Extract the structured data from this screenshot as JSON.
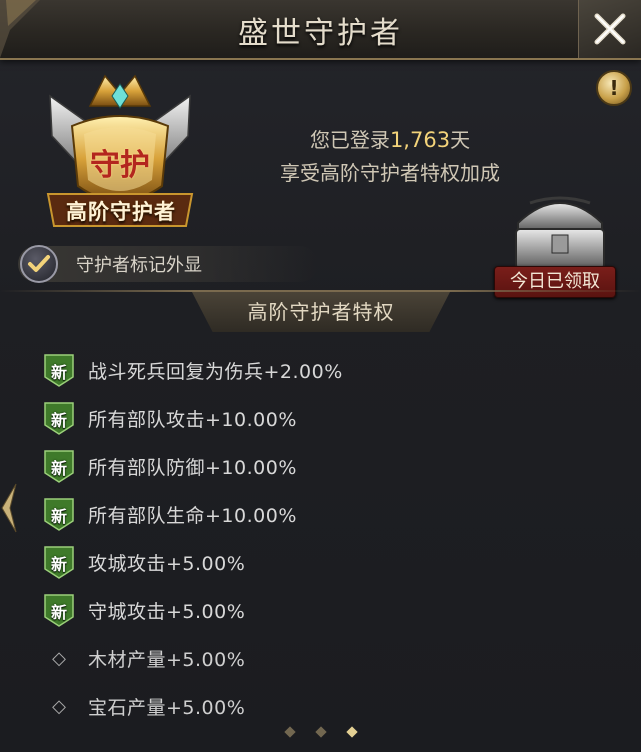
{
  "window": {
    "title": "盛世守护者",
    "close_icon": "close-x-icon",
    "info_icon": "exclamation-icon"
  },
  "emblem": {
    "center_text": "守护",
    "label": "高阶守护者"
  },
  "status": {
    "login_prefix": "您已登录",
    "login_days": "1,763",
    "login_suffix": "天",
    "privilege_line": "享受高阶守护者特权加成"
  },
  "chest": {
    "badge": "今日已领取"
  },
  "display_mark": {
    "label": "守护者标记外显",
    "checked": true
  },
  "privileges": {
    "header": "高阶守护者特权",
    "new_badge": "新",
    "items": [
      {
        "text": "战斗死兵回复为伤兵+2.00%",
        "new": true
      },
      {
        "text": "所有部队攻击+10.00%",
        "new": true
      },
      {
        "text": "所有部队防御+10.00%",
        "new": true
      },
      {
        "text": "所有部队生命+10.00%",
        "new": true
      },
      {
        "text": "攻城攻击+5.00%",
        "new": true
      },
      {
        "text": "守城攻击+5.00%",
        "new": true
      },
      {
        "text": "木材产量+5.00%",
        "new": false
      },
      {
        "text": "宝石产量+5.00%",
        "new": false
      }
    ]
  },
  "pager": {
    "pages": 3,
    "active": 3
  },
  "colors": {
    "accent_gold": "#f3d37a",
    "badge_green": "#3f7a2a",
    "claimed_red": "#7a1e1a"
  }
}
